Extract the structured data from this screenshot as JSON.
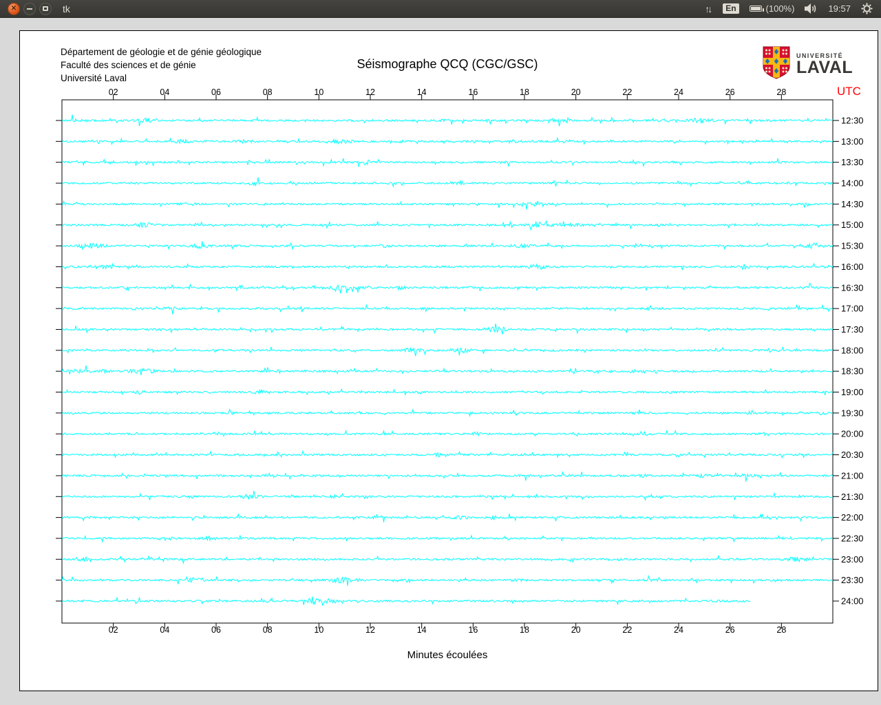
{
  "panel": {
    "title": "tk",
    "icons": {
      "close": "✕",
      "network_up": "↑",
      "network_down": "↓"
    },
    "tray": {
      "keyboard": "En",
      "battery": "(100%)",
      "time": "19:57"
    }
  },
  "document": {
    "institution_lines": [
      "Département de géologie et de génie géologique",
      "Faculté des sciences et de génie",
      "Université Laval"
    ],
    "title": "Séismographe QCQ (CGC/GSC)",
    "x_axis_label": "Minutes écoulées",
    "utc_header": "UTC",
    "logo": {
      "top": "UNIVERSITÉ",
      "bottom": "LAVAL"
    }
  },
  "chart_data": {
    "type": "line",
    "subtype": "helicorder-seismogram",
    "title": "Séismographe QCQ (CGC/GSC)",
    "xlabel": "Minutes écoulées",
    "x_range_minutes": [
      0,
      30
    ],
    "x_tick_minutes": [
      2,
      4,
      6,
      8,
      10,
      12,
      14,
      16,
      18,
      20,
      22,
      24,
      26,
      28
    ],
    "x_tick_labels": [
      "02",
      "04",
      "06",
      "08",
      "10",
      "12",
      "14",
      "16",
      "18",
      "20",
      "22",
      "24",
      "26",
      "28"
    ],
    "rows": 24,
    "row_labels_utc": [
      "12:30",
      "13:00",
      "13:30",
      "14:00",
      "14:30",
      "15:00",
      "15:30",
      "16:00",
      "16:30",
      "17:00",
      "17:30",
      "18:00",
      "18:30",
      "19:00",
      "19:30",
      "20:00",
      "20:30",
      "21:00",
      "21:30",
      "22:00",
      "22:30",
      "23:00",
      "23:30",
      "24:00"
    ],
    "last_row_end_minute": 26.8,
    "trace_color": "#00ffff",
    "axis_color": "#000000",
    "utc_label_color": "#ff0000",
    "description": "24 half-hour rows of low-amplitude seismic background noise; last row (24:00 UTC) still recording, ends near minute 26.8"
  }
}
